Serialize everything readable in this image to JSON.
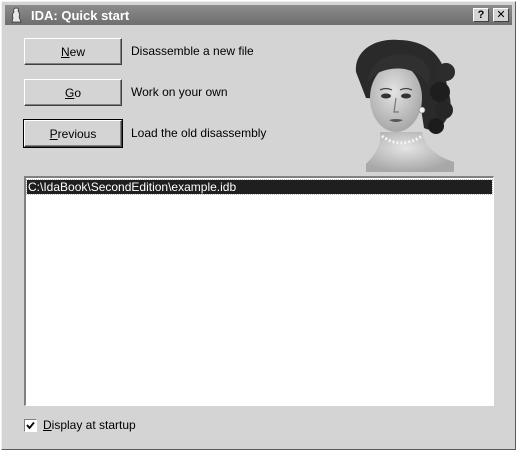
{
  "window": {
    "title": "IDA: Quick start",
    "help_button": "?",
    "close_button": "✕"
  },
  "actions": [
    {
      "key": "N",
      "rest": "ew",
      "description": "Disassemble a new file"
    },
    {
      "key": "G",
      "rest": "o",
      "description": "Work on your own"
    },
    {
      "key": "P",
      "rest": "revious",
      "description": "Load the old disassembly"
    }
  ],
  "recent_files": [
    "C:\\IdaBook\\SecondEdition\\example.idb"
  ],
  "startup": {
    "checked": true,
    "key": "D",
    "rest": "isplay at startup"
  },
  "icons": {
    "app": "ida-figure-icon",
    "help": "help-icon",
    "close": "close-icon",
    "check": "checkmark-icon"
  },
  "colors": {
    "dialog_bg": "#d4d4d4",
    "titlebar": "#7a7a7a",
    "selection": "#1f1f1f"
  }
}
